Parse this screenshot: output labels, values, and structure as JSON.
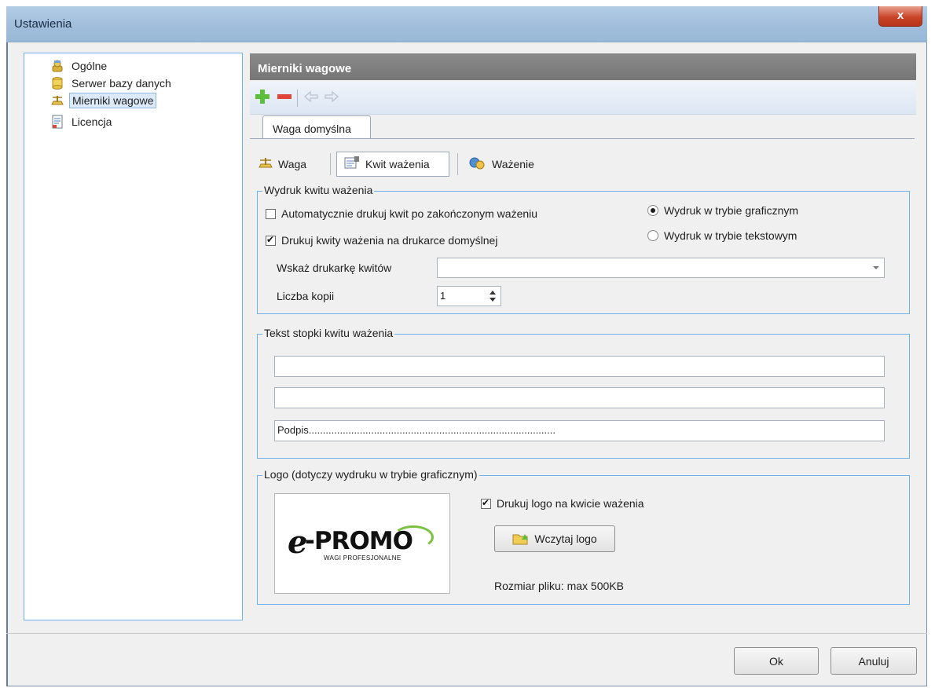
{
  "window": {
    "title": "Ustawienia",
    "close_label": "x"
  },
  "tree": [
    {
      "label": "Ogólne",
      "icon": "general-icon"
    },
    {
      "label": "Serwer bazy danych",
      "icon": "database-icon"
    },
    {
      "label": "Mierniki wagowe",
      "icon": "scale-icon",
      "selected": true
    },
    {
      "label": "Licencja",
      "icon": "license-icon"
    }
  ],
  "panel": {
    "header": "Mierniki wagowe",
    "toolbar": [
      "add-icon",
      "remove-icon",
      "arrow-left-icon",
      "arrow-right-icon"
    ],
    "tab": "Waga domyślna",
    "subtabs": [
      {
        "label": "Waga",
        "icon": "scale-icon"
      },
      {
        "label": "Kwit ważenia",
        "icon": "receipt-icon",
        "selected": true
      },
      {
        "label": "Ważenie",
        "icon": "weighing-icon"
      }
    ]
  },
  "print": {
    "legend": "Wydruk kwitu ważenia",
    "auto_print_label": "Automatycznie drukuj kwit po zakończonym ważeniu",
    "auto_print_checked": false,
    "default_printer_label": "Drukuj kwity ważenia na drukarce domyślnej",
    "default_printer_checked": true,
    "graphic_mode_label": "Wydruk w trybie graficznym",
    "text_mode_label": "Wydruk w trybie tekstowym",
    "mode_selected": "graphic",
    "printer_label": "Wskaż drukarkę kwitów",
    "printer_value": "",
    "copies_label": "Liczba kopii",
    "copies_value": "1"
  },
  "footer_text": {
    "legend": "Tekst stopki kwitu ważenia",
    "lines": [
      "",
      "",
      "Podpis......................................................................................."
    ]
  },
  "logo": {
    "legend": "Logo (dotyczy wydruku w trybie graficznym)",
    "print_logo_label": "Drukuj logo na kwicie ważenia",
    "print_logo_checked": true,
    "load_button": "Wczytaj logo",
    "size_note": "Rozmiar pliku: max 500KB",
    "brand_main": "-PROMO",
    "brand_prefix": "e",
    "brand_tagline": "WAGI PROFESJONALNE"
  },
  "buttons": {
    "ok": "Ok",
    "cancel": "Anuluj"
  },
  "colors": {
    "accent": "#6fb1ea",
    "header": "#7d7d7d",
    "brand_green": "#7cc242"
  }
}
